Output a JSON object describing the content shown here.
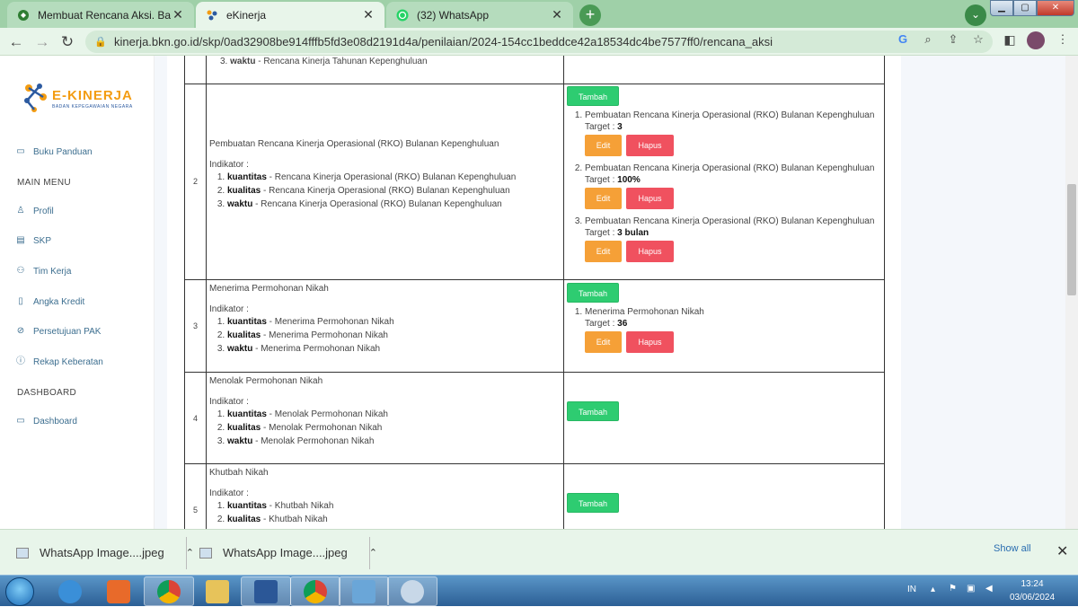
{
  "browser": {
    "tabs": [
      {
        "label": "Membuat Rencana Aksi. Bagian I",
        "icon": "ekin-icon"
      },
      {
        "label": "eKinerja",
        "icon": "ekinerja-icon"
      },
      {
        "label": "(32) WhatsApp",
        "icon": "whatsapp-icon"
      }
    ],
    "url": "kinerja.bkn.go.id/skp/0ad32908be914fffb5fd3e08d2191d4a/penilaian/2024-154cc1beddce42a18534dc4be7577ff0/rencana_aksi",
    "accent": "#4a9a55"
  },
  "sidebar": {
    "logo_name": "E-KINERJA",
    "logo_sub": "BADAN KEPEGAWAIAN NEGARA",
    "buku": "Buku Panduan",
    "main_menu": "MAIN MENU",
    "items": [
      "Profil",
      "SKP",
      "Tim Kerja",
      "Angka Kredit",
      "Persetujuan PAK",
      "Rekap Keberatan"
    ],
    "dashboard_head": "DASHBOARD",
    "dashboard": "Dashboard"
  },
  "table": {
    "top_row": {
      "num": "3.",
      "kw": "waktu",
      "text": "- Rencana Kinerja Tahunan Kepenghuluan"
    },
    "rows": [
      {
        "no": "2",
        "title": "Pembuatan Rencana Kinerja Operasional (RKO) Bulanan Kepenghuluan",
        "indikator_label": "Indikator :",
        "ind": [
          {
            "kw": "kuantitas",
            "text": " - Rencana Kinerja Operasional (RKO) Bulanan Kepenghuluan"
          },
          {
            "kw": "kualitas",
            "text": " - Rencana Kinerja Operasional (RKO) Bulanan Kepenghuluan"
          },
          {
            "kw": "waktu",
            "text": " - Rencana Kinerja Operasional (RKO) Bulanan Kepenghuluan"
          }
        ],
        "rk": [
          {
            "text": "Pembuatan Rencana Kinerja Operasional (RKO) Bulanan Kepenghuluan",
            "target": "3"
          },
          {
            "text": "Pembuatan Rencana Kinerja Operasional (RKO) Bulanan Kepenghuluan",
            "target": "100%"
          },
          {
            "text": "Pembuatan Rencana Kinerja Operasional (RKO) Bulanan Kepenghuluan",
            "target": "3 bulan"
          }
        ]
      },
      {
        "no": "3",
        "title": "Menerima Permohonan Nikah",
        "indikator_label": "Indikator :",
        "ind": [
          {
            "kw": "kuantitas",
            "text": " - Menerima Permohonan Nikah"
          },
          {
            "kw": "kualitas",
            "text": " - Menerima Permohonan Nikah"
          },
          {
            "kw": "waktu",
            "text": " - Menerima Permohonan Nikah"
          }
        ],
        "rk": [
          {
            "text": "Menerima Permohonan Nikah",
            "target": "36"
          }
        ]
      },
      {
        "no": "4",
        "title": "Menolak Permohonan Nikah",
        "indikator_label": "Indikator :",
        "ind": [
          {
            "kw": "kuantitas",
            "text": " - Menolak Permohonan Nikah"
          },
          {
            "kw": "kualitas",
            "text": " - Menolak Permohonan Nikah"
          },
          {
            "kw": "waktu",
            "text": " - Menolak Permohonan Nikah"
          }
        ],
        "rk": []
      },
      {
        "no": "5",
        "title": "Khutbah Nikah",
        "indikator_label": "Indikator :",
        "ind": [
          {
            "kw": "kuantitas",
            "text": " - Khutbah Nikah"
          },
          {
            "kw": "kualitas",
            "text": " - Khutbah Nikah"
          }
        ],
        "rk": []
      }
    ],
    "tambah": "Tambah",
    "edit": "Edit",
    "hapus": "Hapus",
    "target_label": "Target :"
  },
  "downloads": {
    "items": [
      "WhatsApp Image....jpeg",
      "WhatsApp Image....jpeg"
    ],
    "show_all": "Show all"
  },
  "taskbar": {
    "lang": "IN",
    "time": "13:24",
    "date": "03/06/2024"
  }
}
